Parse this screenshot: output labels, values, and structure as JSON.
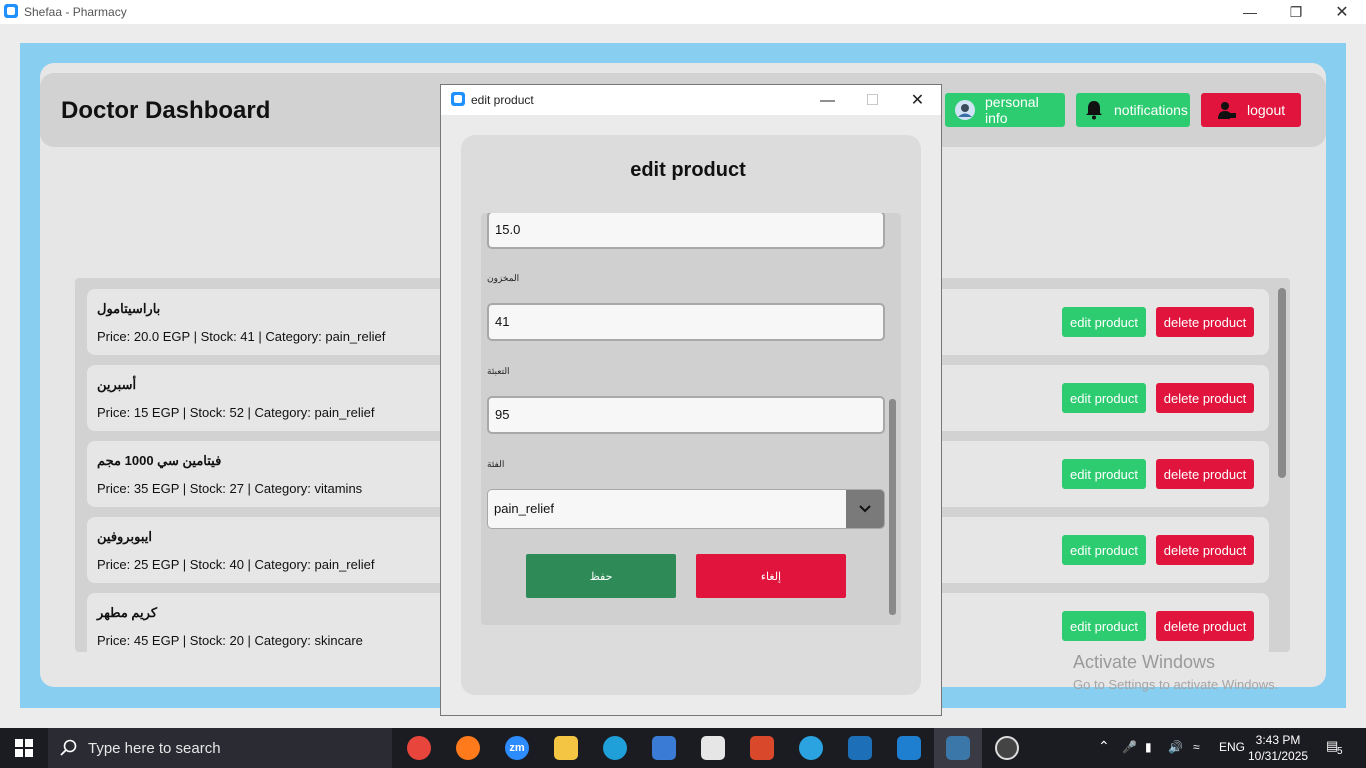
{
  "window": {
    "title": "Shefaa - Pharmacy"
  },
  "header": {
    "title": "Doctor Dashboard",
    "personal_info_label": "personal info",
    "notifications_label": "notifications",
    "logout_label": "logout"
  },
  "products": [
    {
      "name": "باراسيتامول",
      "info": "Price: 20.0 EGP | Stock: 41 | Category: pain_relief"
    },
    {
      "name": "أسبرين",
      "info": "Price: 15 EGP | Stock: 52 | Category: pain_relief"
    },
    {
      "name": "فيتامين سي 1000 مجم",
      "info": "Price: 35 EGP | Stock: 27 | Category: vitamins"
    },
    {
      "name": "ايبوبروفين",
      "info": "Price: 25 EGP | Stock: 40 | Category: pain_relief"
    },
    {
      "name": "كريم مطهر",
      "info": "Price: 45 EGP | Stock: 20 | Category: skincare"
    }
  ],
  "row_actions": {
    "edit_label": "edit product",
    "delete_label": "delete product"
  },
  "watermark": {
    "line1": "Activate Windows",
    "line2": "Go to Settings to activate Windows."
  },
  "dialog": {
    "window_title": "edit product",
    "heading": "edit product",
    "price_value": "15.0",
    "stock_label": "المخزون",
    "stock_value": "41",
    "pack_label": "التعبئة",
    "pack_value": "95",
    "category_label": "الفئة",
    "category_value": "pain_relief",
    "save_label": "حفظ",
    "cancel_label": "إلغاء"
  },
  "taskbar": {
    "search_placeholder": "Type here to search",
    "language": "ENG",
    "time": "3:43 PM",
    "date": "10/31/2025",
    "notification_count": "5"
  }
}
